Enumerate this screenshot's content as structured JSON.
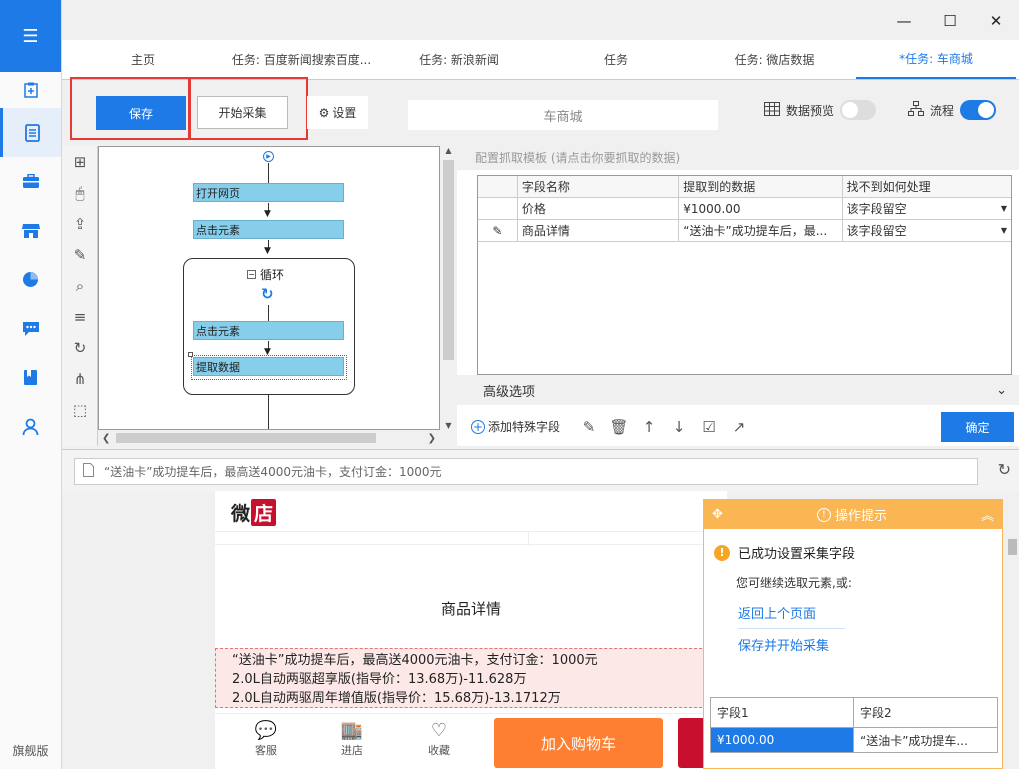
{
  "sidebar": {
    "edition_label": "旗舰版"
  },
  "tabs": [
    {
      "label": "主页"
    },
    {
      "label": "任务: 百度新闻搜索百度..."
    },
    {
      "label": "任务: 新浪新闻"
    },
    {
      "label": "任务"
    },
    {
      "label": "任务: 微店数据"
    },
    {
      "label": "*任务: 车商城"
    }
  ],
  "toolbar": {
    "save_label": "保存",
    "start_label": "开始采集",
    "settings_label": "设置",
    "task_name": "车商城",
    "data_preview_label": "数据预览",
    "data_preview_on": false,
    "flow_label": "流程",
    "flow_on": true
  },
  "flow": {
    "open_page": "打开网页",
    "click_element_1": "点击元素",
    "loop_label": "循环",
    "click_element_2": "点击元素",
    "extract_data": "提取数据"
  },
  "config": {
    "header": "配置抓取模板 (请点击你要抓取的数据)",
    "columns": [
      "字段名称",
      "提取到的数据",
      "找不到如何处理"
    ],
    "rows": [
      {
        "name": "价格",
        "value": "¥1000.00",
        "handling": "该字段留空"
      },
      {
        "name": "商品详情",
        "value": "“送油卡”成功提车后，最...",
        "handling": "该字段留空"
      }
    ],
    "advanced_label": "高级选项",
    "add_field_label": "添加特殊字段",
    "ok_label": "确定"
  },
  "browser": {
    "address_text": "“送油卡”成功提车后，最高送4000元油卡，支付订金：1000元",
    "logo_text": "微",
    "logo_red_text": "店",
    "detail_title": "商品详情",
    "detail_lines": [
      "“送油卡”成功提车后，最高送4000元油卡，支付订金：1000元",
      "2.0L自动两驱超享版(指导价：13.68万)-11.628万",
      "2.0L自动两驱周年增值版(指导价：15.68万)-13.1712万"
    ],
    "nav_service": "客服",
    "nav_shop": "进店",
    "nav_fav": "收藏",
    "cart_label": "加入购物车"
  },
  "tips": {
    "title": "操作提示",
    "success_msg": "已成功设置采集字段",
    "sub_msg": "您可继续选取元素,或:",
    "link_back": "返回上个页面",
    "link_save_start": "保存并开始采集",
    "table_headers": [
      "字段1",
      "字段2"
    ],
    "table_row": [
      "¥1000.00",
      "“送油卡”成功提车..."
    ]
  },
  "colors": {
    "accent": "#1e7ae6",
    "highlight": "#e53935",
    "tips_header": "#f9b653"
  }
}
